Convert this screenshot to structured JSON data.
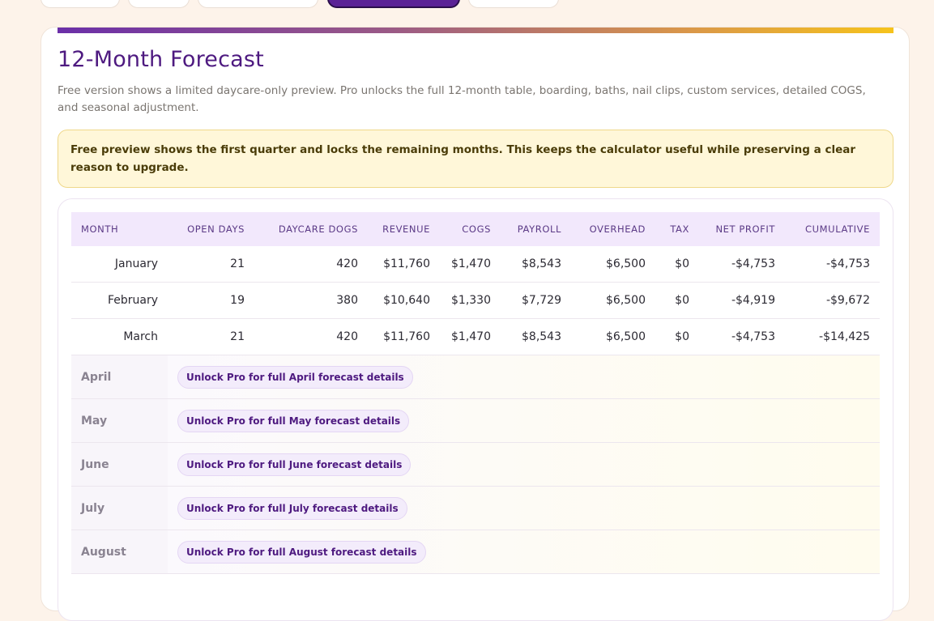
{
  "title": "12-Month Forecast",
  "subtitle": "Free version shows a limited daycare-only preview. Pro unlocks the full 12-month table, boarding, baths, nail clips, custom services, detailed COGS, and seasonal adjustment.",
  "notice": "Free preview shows the first quarter and locks the remaining months. This keeps the calculator useful while preserving a clear reason to upgrade.",
  "colors": {
    "accent": "#4e1a80",
    "active_tab": "#5b2296",
    "gradient_start": "#6b2fa8",
    "gradient_end": "#f6c31c",
    "notice_bg": "#fff7d9",
    "header_bg": "#f2e8fc"
  },
  "table": {
    "columns": [
      "MONTH",
      "OPEN DAYS",
      "DAYCARE DOGS",
      "REVENUE",
      "COGS",
      "PAYROLL",
      "OVERHEAD",
      "TAX",
      "NET PROFIT",
      "CUMULATIVE"
    ],
    "rows": [
      [
        "January",
        "21",
        "420",
        "$11,760",
        "$1,470",
        "$8,543",
        "$6,500",
        "$0",
        "-$4,753",
        "-$4,753"
      ],
      [
        "February",
        "19",
        "380",
        "$10,640",
        "$1,330",
        "$7,729",
        "$6,500",
        "$0",
        "-$4,919",
        "-$9,672"
      ],
      [
        "March",
        "21",
        "420",
        "$11,760",
        "$1,470",
        "$8,543",
        "$6,500",
        "$0",
        "-$4,753",
        "-$14,425"
      ]
    ],
    "locked_rows": [
      {
        "month": "April",
        "cta": "Unlock Pro for full April forecast details"
      },
      {
        "month": "May",
        "cta": "Unlock Pro for full May forecast details"
      },
      {
        "month": "June",
        "cta": "Unlock Pro for full June forecast details"
      },
      {
        "month": "July",
        "cta": "Unlock Pro for full July forecast details"
      },
      {
        "month": "August",
        "cta": "Unlock Pro for full August forecast details"
      }
    ]
  }
}
